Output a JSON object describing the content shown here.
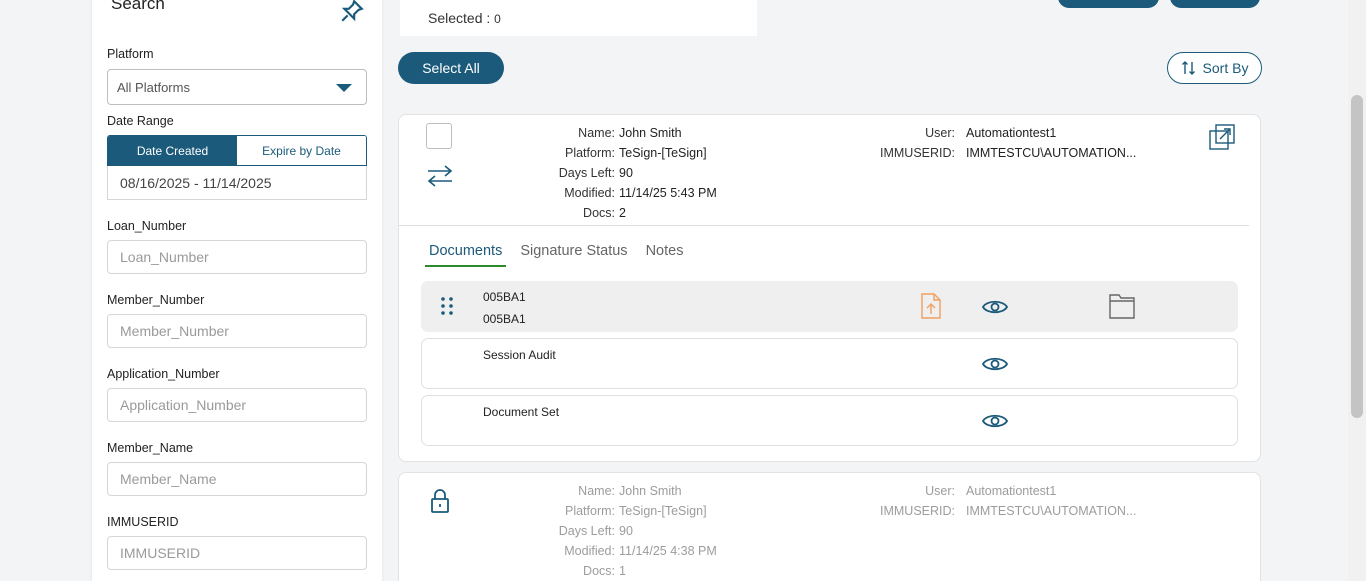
{
  "sidebar": {
    "title": "Search",
    "platform": {
      "label": "Platform",
      "value": "All Platforms"
    },
    "date_range": {
      "label": "Date Range",
      "created_tab": "Date Created",
      "expire_tab": "Expire by Date",
      "value": "08/16/2025 - 11/14/2025"
    },
    "fields": [
      {
        "label": "Loan_Number",
        "placeholder": "Loan_Number"
      },
      {
        "label": "Member_Number",
        "placeholder": "Member_Number"
      },
      {
        "label": "Application_Number",
        "placeholder": "Application_Number"
      },
      {
        "label": "Member_Name",
        "placeholder": "Member_Name"
      },
      {
        "label": "IMMUSERID",
        "placeholder": "IMMUSERID"
      }
    ]
  },
  "toolbar": {
    "selected_label": "Selected :",
    "selected_count": "0",
    "select_all": "Select All",
    "sort_by": "Sort By"
  },
  "cards": [
    {
      "name_k": "Name:",
      "name": "John Smith",
      "platform_k": "Platform:",
      "platform": "TeSign-[TeSign]",
      "days_k": "Days Left:",
      "days": "90",
      "modified_k": "Modified:",
      "modified": "11/14/25 5:43 PM",
      "docs_k": "Docs:",
      "docs": "2",
      "user_k": "User:",
      "user": "Automationtest1",
      "immuserid_k": "IMMUSERID:",
      "immuserid": "IMMTESTCU\\AUTOMATION..."
    },
    {
      "name_k": "Name:",
      "name": "John Smith",
      "platform_k": "Platform:",
      "platform": "TeSign-[TeSign]",
      "days_k": "Days Left:",
      "days": "90",
      "modified_k": "Modified:",
      "modified": "11/14/25 4:38 PM",
      "docs_k": "Docs:",
      "docs": "1",
      "user_k": "User:",
      "user": "Automationtest1",
      "immuserid_k": "IMMUSERID:",
      "immuserid": "IMMTESTCU\\AUTOMATION..."
    }
  ],
  "tabs": [
    "Documents",
    "Signature Status",
    "Notes"
  ],
  "documents": [
    {
      "line1": "005BA1",
      "line2": "005BA1"
    },
    {
      "line1": "Session Audit"
    },
    {
      "line1": "Document Set"
    }
  ],
  "colors": {
    "primary": "#1b5a7a",
    "upload": "#f0a060",
    "tab_underline": "#2d8a2d"
  }
}
